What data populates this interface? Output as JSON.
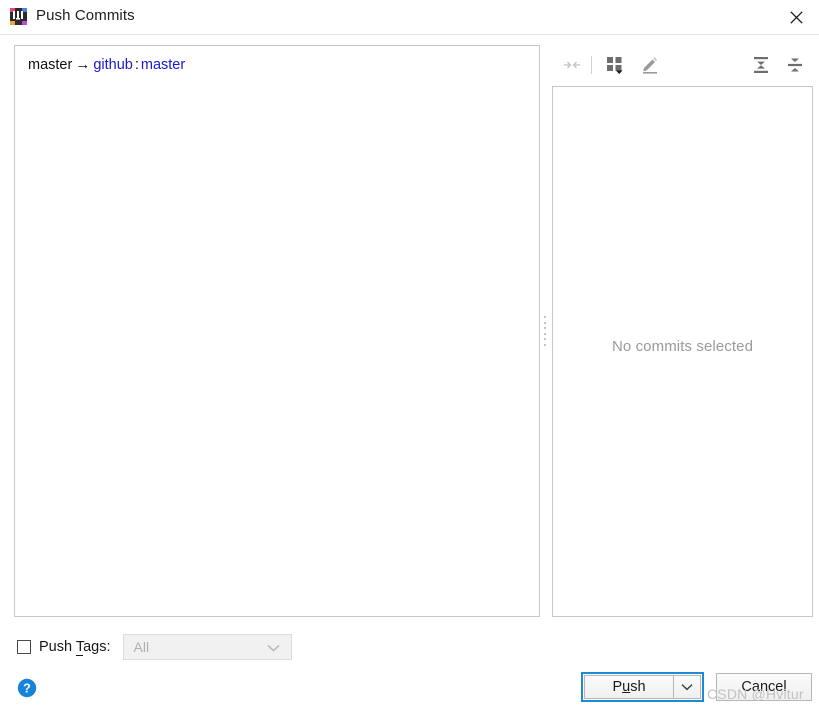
{
  "window": {
    "title": "Push Commits",
    "app_icon": "intellij-idea-icon",
    "close_label": "×"
  },
  "branch": {
    "local": "master",
    "arrow": "→",
    "remote": "github",
    "separator": ":",
    "target": "master"
  },
  "toolbar": {
    "items": [
      {
        "name": "collapse-arrows-icon",
        "label": "Collapse",
        "disabled": true
      },
      {
        "name": "group-by-icon",
        "label": "Group By",
        "disabled": false
      },
      {
        "name": "edit-pencil-icon",
        "label": "Edit Commit Message",
        "disabled": false
      },
      {
        "name": "expand-all-icon",
        "label": "Expand All",
        "disabled": false
      },
      {
        "name": "collapse-all-icon",
        "label": "Collapse All",
        "disabled": false
      }
    ]
  },
  "details": {
    "empty_message": "No commits selected"
  },
  "push_tags": {
    "label_before": "Push ",
    "label_mnemonic": "T",
    "label_after": "ags:",
    "checked": false,
    "combo_value": "All",
    "combo_enabled": false
  },
  "footer": {
    "help_label": "?",
    "push_label_before": "P",
    "push_label_mnemonic": "u",
    "push_label_after": "sh",
    "push_dropdown": "chevron-down-icon",
    "cancel_label": "Cancel",
    "watermark": "CSDN @Hvitur"
  },
  "colors": {
    "accent_blue": "#1e8ad6",
    "branch_blue": "#1919d6",
    "help_blue": "#1884d8",
    "placeholder_gray": "#9a9a9a",
    "border_gray": "#c8c8c8"
  }
}
